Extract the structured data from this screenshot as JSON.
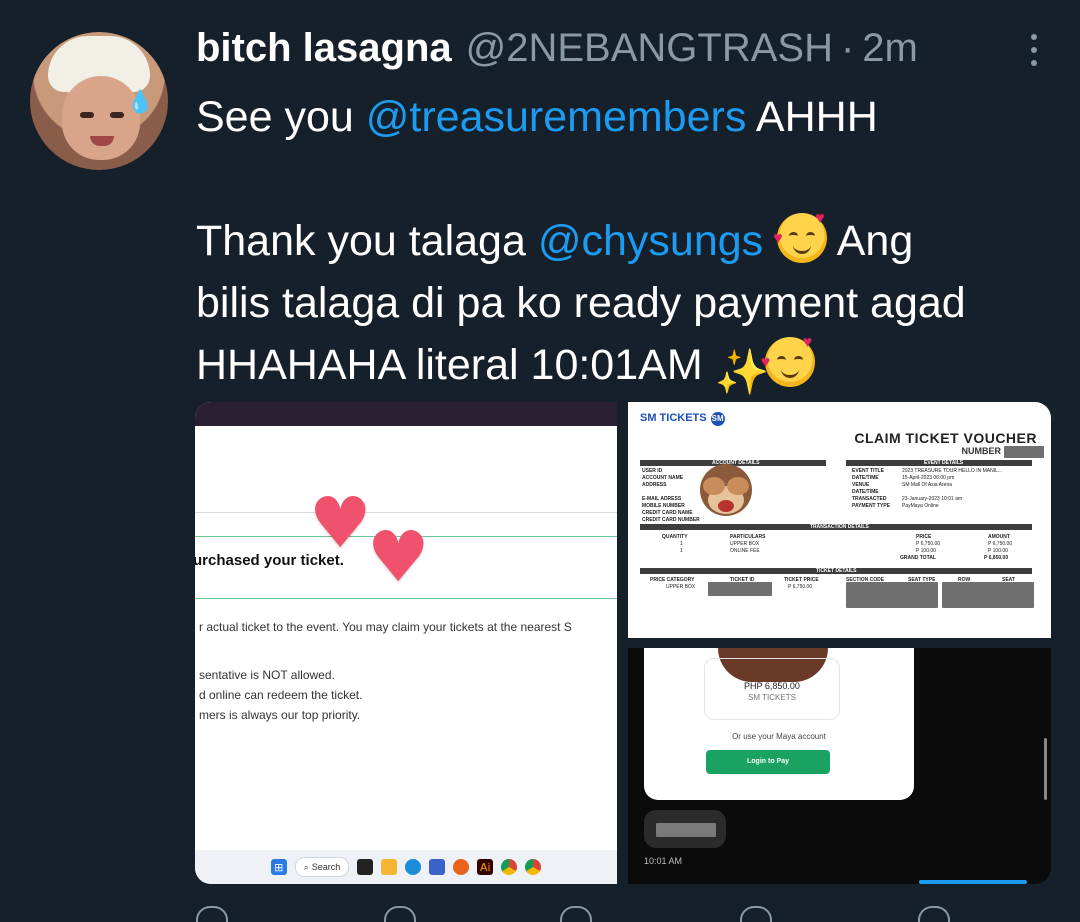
{
  "tweet": {
    "display_name": "bitch lasagna",
    "handle": "@2NEBANGTRASH",
    "separator": "·",
    "timestamp": "2m",
    "lines": {
      "l1_pre": "See you ",
      "l1_mention": "@treasuremembers",
      "l1_post": " AHHH",
      "l3_pre": "Thank you talaga ",
      "l3_mention": "@chysungs",
      "l3_post": "  Ang",
      "l4": "bilis talaga di pa ko ready payment agad",
      "l5": "HHAHAHA literal 10:01AM "
    }
  },
  "media": {
    "left": {
      "purchased_text": "urchased your ticket.",
      "note1": "r actual ticket to the event. You may claim your tickets at the nearest S",
      "note2": "sentative is NOT allowed.",
      "note3": "d online can redeem the ticket.",
      "note4": "mers is always our top priority.",
      "taskbar_search": "Search"
    },
    "voucher": {
      "logo": "SM TICKETS",
      "title": "CLAIM TICKET VOUCHER",
      "number_label": "NUMBER",
      "account_details": "ACCOUNT DETAILS",
      "event_details": "EVENT DETAILS",
      "transaction_details": "TRANSACTION DETAILS",
      "ticket_details": "TICKET DETAILS",
      "left_labels": [
        "USER ID",
        "ACCOUNT NAME",
        "ADDRESS",
        "",
        "E-MAIL ADRESS",
        "MOBILE NUMBER",
        "CREDIT CARD NAME",
        "CREDIT CARD NUMBER"
      ],
      "right_labels": [
        "EVENT TITLE",
        "DATE/TIME",
        "VENUE",
        "DATE/TIME",
        "TRANSACTED",
        "PAYMENT TYPE"
      ],
      "right_values": [
        "2023 TREASURE TOUR HELLO IN MANIL...",
        "15-April-2023 06:00 pm",
        "SM Mall Of Asia Arena",
        "",
        "23-January-2023 10:01 am",
        "PayMaya Online"
      ],
      "trans_headers": [
        "QUANTITY",
        "PARTICULARS",
        "PRICE",
        "AMOUNT"
      ],
      "trans_rows": [
        [
          "1",
          "UPPER BOX",
          "P 6,750.00",
          "P 6,750.00"
        ],
        [
          "1",
          "ONLINE FEE",
          "P 100.00",
          "P 100.00"
        ]
      ],
      "grand_total_label": "GRAND TOTAL",
      "grand_total_value": "P 6,850.00",
      "ticket_headers": [
        "PRICE CATEGORY",
        "TICKET ID",
        "TICKET PRICE",
        "SECTION CODE",
        "SEAT TYPE",
        "ROW",
        "SEAT"
      ],
      "ticket_row": [
        "UPPER BOX",
        "",
        "P 6,750.00"
      ]
    },
    "payment": {
      "amount": "PHP 6,850.00",
      "merchant": "SM TICKETS",
      "maya_prompt": "Or use your Maya account",
      "login_label": "Login to Pay",
      "chat_time": "10:01 AM"
    }
  },
  "icons": {
    "more": "more-dots-icon",
    "emoji_love": "smiling-face-with-hearts-emoji",
    "emoji_sparkles": "sparkles-emoji"
  },
  "colors": {
    "background": "#15202b",
    "mention": "#1d9bf0",
    "secondary_text": "#8b98a5",
    "login_button": "#1aa260"
  }
}
